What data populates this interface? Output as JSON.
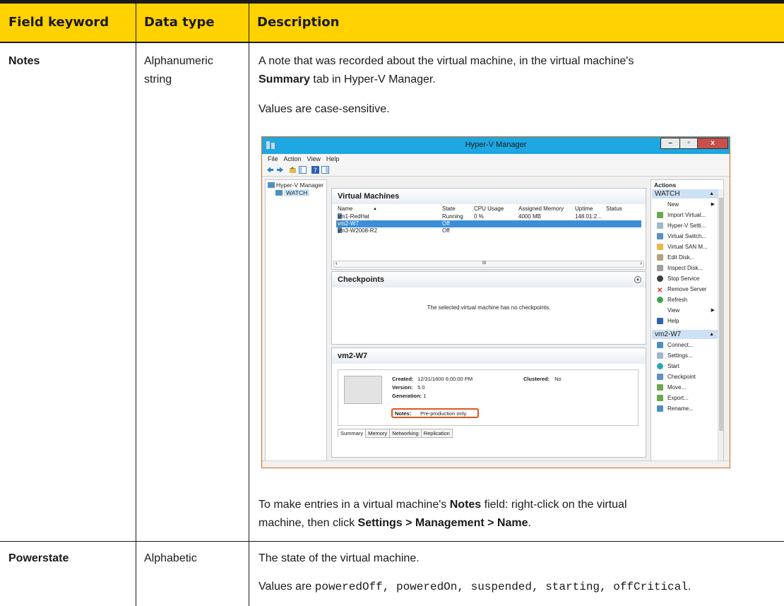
{
  "table": {
    "headers": [
      "Field keyword",
      "Data type",
      "Description"
    ],
    "notes_row": {
      "keyword": "Notes",
      "type_line1": "Alphanumeric",
      "type_line2": "string",
      "desc_line1": "A note that was recorded about the virtual machine, in the virtual machine's",
      "desc_line2_bold": "Summary",
      "desc_line2_rest": " tab in Hyper-V Manager.",
      "case_note": "Values are case-sensitive.",
      "instr_pre": "To make entries in a virtual machine's ",
      "instr_bold1": "Notes",
      "instr_post1": " field: right-click on the virtual",
      "instr_line2_pre": "machine, then click ",
      "instr_bold2": "Settings > Management > Name",
      "instr_line2_post": "."
    },
    "powerstate_row": {
      "keyword": "Powerstate",
      "type": "Alphabetic",
      "desc": "The state of the virtual machine.",
      "values_pre": "Values are ",
      "values_codes": "poweredOff, poweredOn, suspended, starting, offCritical",
      "values_post": "."
    }
  },
  "colors": {
    "header_bg": "#ffd200",
    "titlebar": "#1ea7e2",
    "highlight": "#e2541d"
  },
  "screenshot": {
    "window_title": "Hyper-V Manager",
    "win_buttons": [
      "–",
      "▫",
      "x"
    ],
    "menu": [
      "File",
      "Action",
      "View",
      "Help"
    ],
    "tree": {
      "root": "Hyper-V Manager",
      "child": "WATCH"
    },
    "vm_pane": {
      "title": "Virtual Machines",
      "columns": [
        "Name",
        "State",
        "CPU Usage",
        "Assigned Memory",
        "Uptime",
        "Status"
      ],
      "rows": [
        {
          "name": "vm1-RedHat",
          "state": "Running",
          "cpu": "0 %",
          "mem": "4000 MB",
          "uptime": "148.01:2...",
          "status": ""
        },
        {
          "name": "vm2-W7",
          "state": "Off",
          "cpu": "",
          "mem": "",
          "uptime": "",
          "status": ""
        },
        {
          "name": "vm3-W2008-R2",
          "state": "Off",
          "cpu": "",
          "mem": "",
          "uptime": "",
          "status": ""
        }
      ],
      "scroll_mark": "III"
    },
    "checkpoints": {
      "title": "Checkpoints",
      "message": "The selected virtual machine has no checkpoints."
    },
    "details": {
      "title": "vm2-W7",
      "created_label": "Created:",
      "created_value": "12/31/1600 6:00:00 PM",
      "clustered_label": "Clustered:",
      "clustered_value": "No",
      "version_label": "Version:",
      "version_value": "5.0",
      "generation_label": "Generation:",
      "generation_value": "1",
      "notes_label": "Notes:",
      "notes_value": "Pre-production only.",
      "tabs": [
        "Summary",
        "Memory",
        "Networking",
        "Replication"
      ]
    },
    "actions": {
      "title": "Actions",
      "section1": "WATCH",
      "items1": [
        "New",
        "Import Virtual...",
        "Hyper-V Setti...",
        "Virtual Switch...",
        "Virtual SAN M...",
        "Edit Disk...",
        "Inspect Disk...",
        "Stop Service",
        "Remove Server",
        "Refresh",
        "View",
        "Help"
      ],
      "section2": "vm2-W7",
      "items2": [
        "Connect...",
        "Settings...",
        "Start",
        "Checkpoint",
        "Move...",
        "Export...",
        "Rename..."
      ]
    }
  }
}
